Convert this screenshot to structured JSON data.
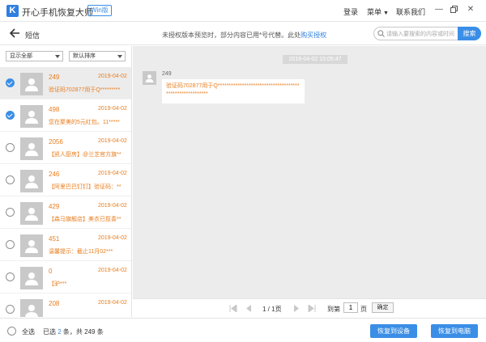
{
  "app": {
    "logo_letter": "K",
    "title": "开心手机恢复大师",
    "edition_badge": "Win版",
    "nav": {
      "login": "登录",
      "menu": "菜单",
      "contact": "联系我们"
    },
    "brand_color": "#2f7fe0"
  },
  "header": {
    "section_title": "短信",
    "notice_text": "未授权版本预览时，部分内容已用*号代替。此处",
    "notice_link": "购买授权",
    "search_placeholder": "请输入要搜索的内容或时间",
    "search_button": "搜索"
  },
  "filters": {
    "show": "显示全部",
    "sort": "默认排序"
  },
  "messages": [
    {
      "sender": "249",
      "date": "2019-04-02",
      "preview": "验证码702877用于Q*********",
      "checked": true,
      "selected": true
    },
    {
      "sender": "498",
      "date": "2019-04-02",
      "preview": "您在聚美的5元红包。11*****",
      "checked": true,
      "selected": false
    },
    {
      "sender": "2056",
      "date": "2019-04-02",
      "preview": "【凯人厨房】@兰芝官方旗**",
      "checked": false,
      "selected": false
    },
    {
      "sender": "246",
      "date": "2019-04-02",
      "preview": "【阿里巴巴钉钉】验证码：**",
      "checked": false,
      "selected": false
    },
    {
      "sender": "429",
      "date": "2019-04-02",
      "preview": "【森马旗舰店】美衣已揽奏**",
      "checked": false,
      "selected": false
    },
    {
      "sender": "451",
      "date": "2019-04-02",
      "preview": "温馨提示：截止11月02***",
      "checked": false,
      "selected": false
    },
    {
      "sender": "0",
      "date": "2019-04-02",
      "preview": "【驴***",
      "checked": false,
      "selected": false
    },
    {
      "sender": "208",
      "date": "2019-04-02",
      "preview": "",
      "checked": false,
      "selected": false
    }
  ],
  "chat": {
    "timestamp": "2019-04-02 15:05:47",
    "sender": "249",
    "message": "验证码702877用于Q********************************************************"
  },
  "pagination": {
    "page_display": "1 / 1页",
    "goto_label": "到第",
    "goto_value": "1",
    "page_suffix": "页",
    "confirm": "确定"
  },
  "footer": {
    "select_all": "全选",
    "selected_prefix": "已选",
    "selected_count": "2",
    "selected_mid": "条，共",
    "total_count": "249",
    "selected_suffix": "条",
    "restore_device": "恢复到设备",
    "restore_pc": "恢复到电脑"
  },
  "colors": {
    "accent": "#3a8ee6",
    "highlight_text": "#e87d1e"
  }
}
